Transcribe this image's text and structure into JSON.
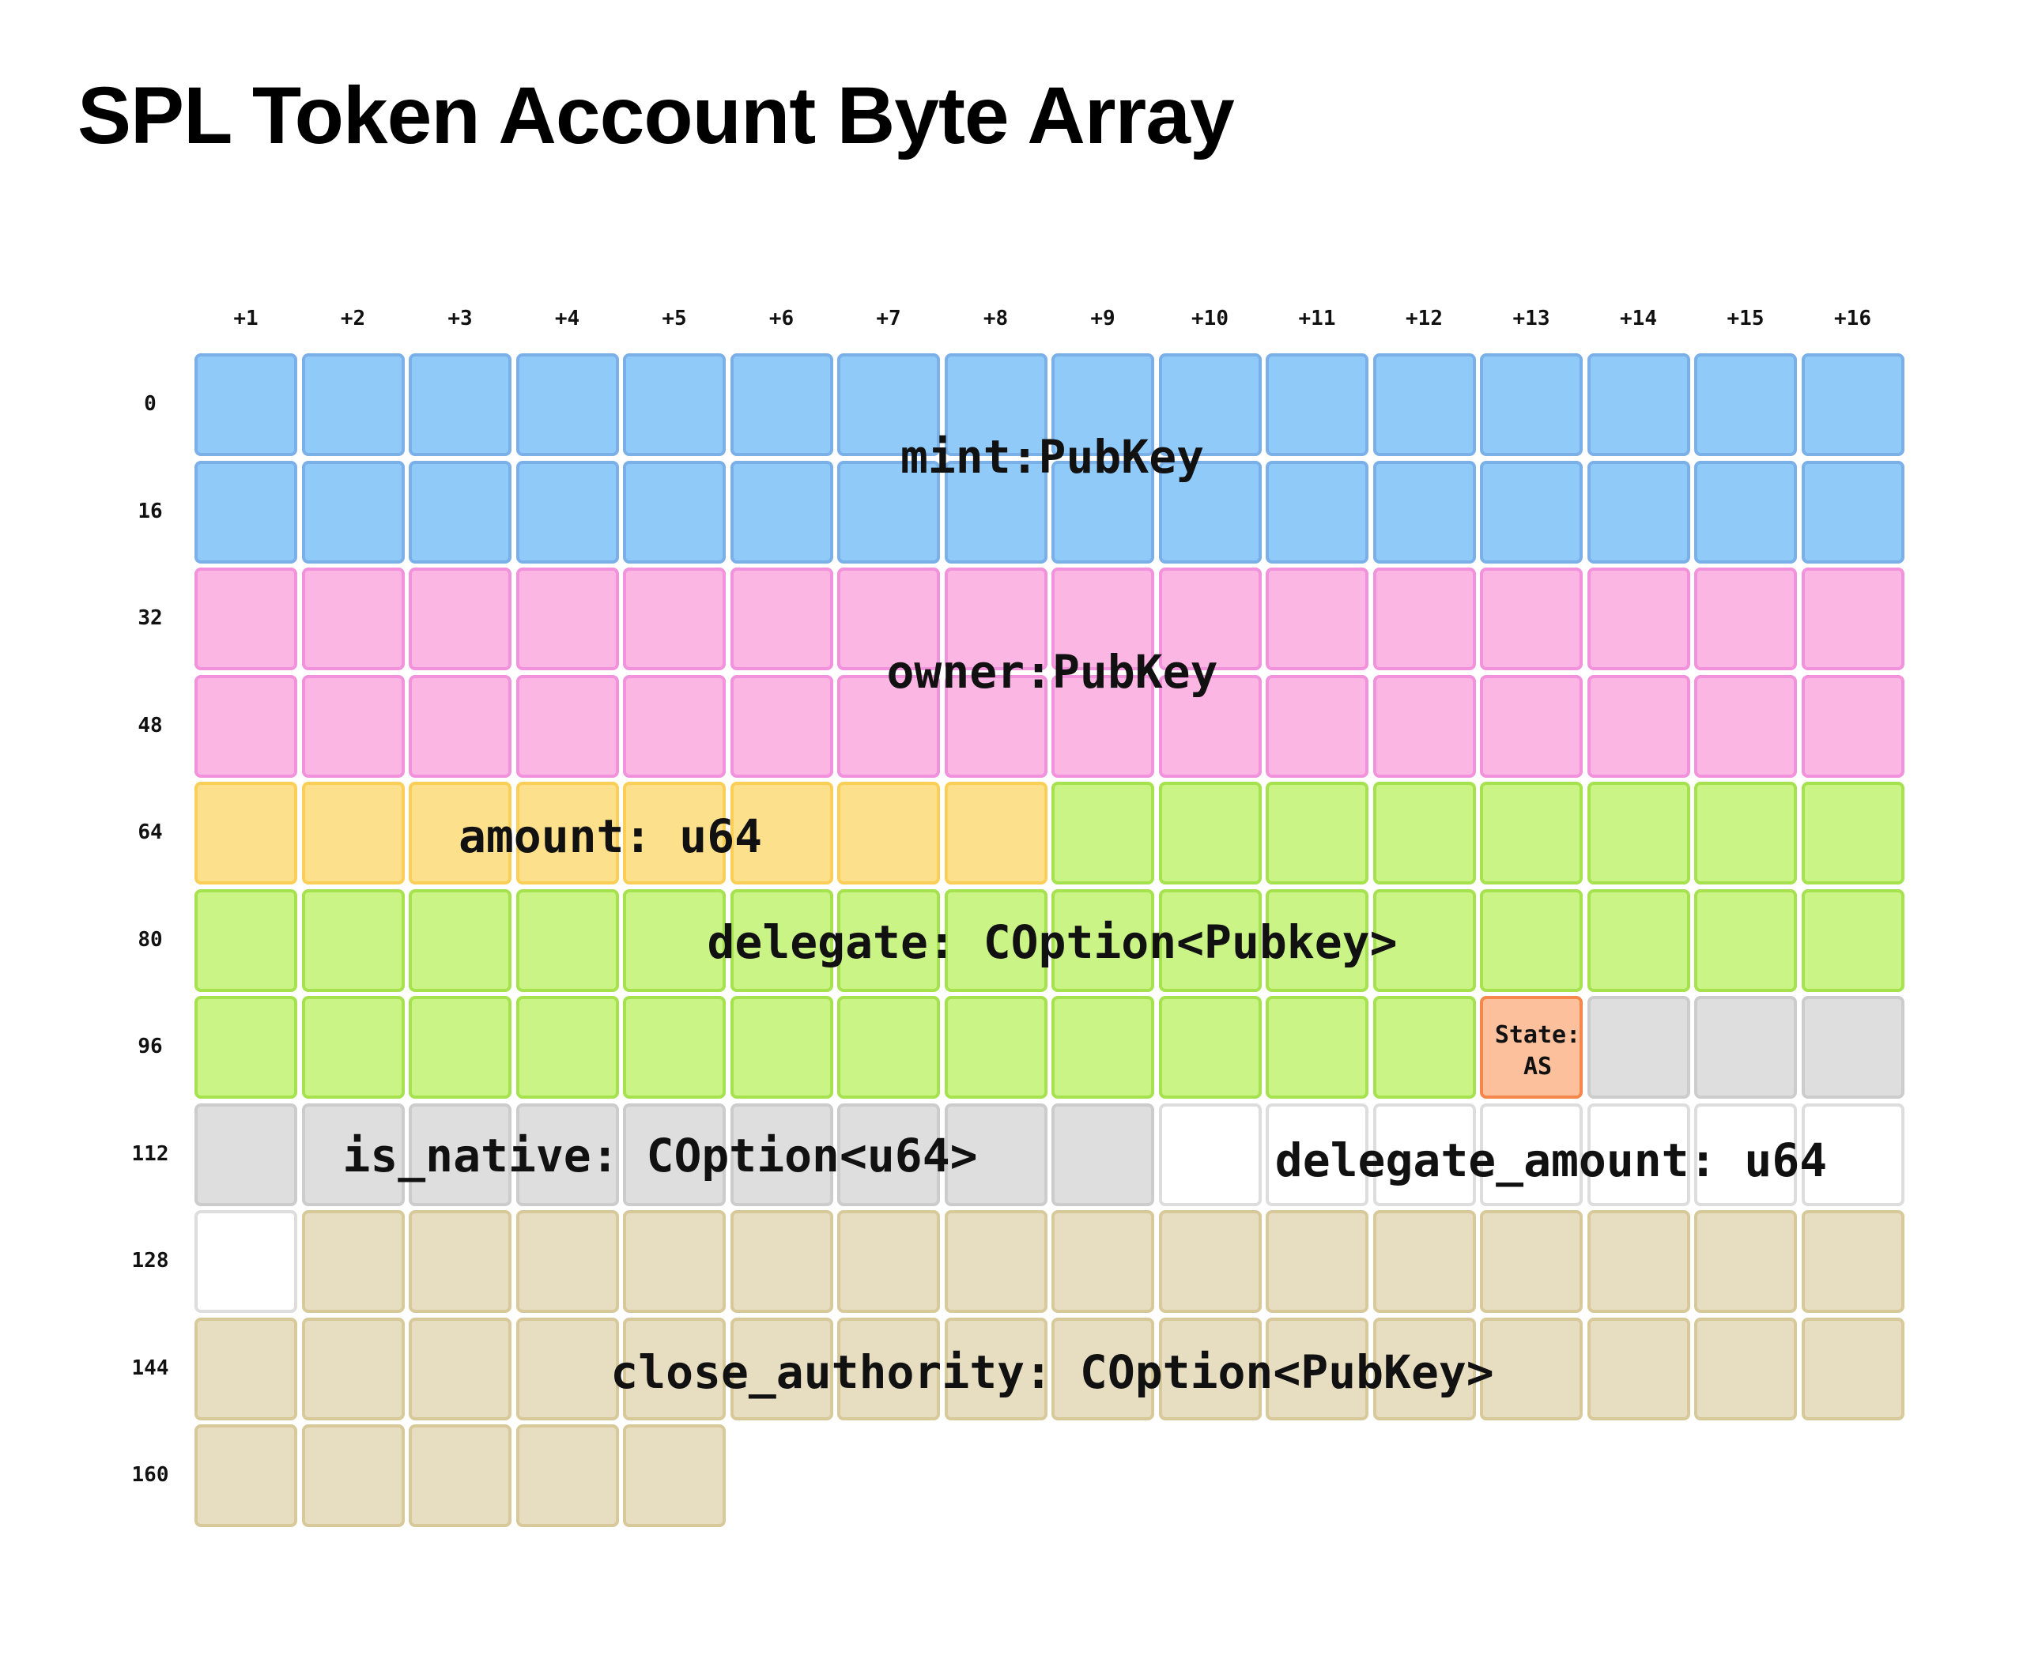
{
  "title": "SPL Token Account Byte Array",
  "column_headers": [
    "+1",
    "+2",
    "+3",
    "+4",
    "+5",
    "+6",
    "+7",
    "+8",
    "+9",
    "+10",
    "+11",
    "+12",
    "+13",
    "+14",
    "+15",
    "+16"
  ],
  "row_headers": [
    "0",
    "16",
    "32",
    "48",
    "64",
    "80",
    "96",
    "112",
    "128",
    "144",
    "160"
  ],
  "total_bytes": 165,
  "fields": [
    {
      "id": "mint",
      "label": "mint:PubKey",
      "start": 0,
      "length": 32,
      "fill": "#90caf9",
      "border": "#7aafe8"
    },
    {
      "id": "owner",
      "label": "owner:PubKey",
      "start": 32,
      "length": 32,
      "fill": "#fbb6e3",
      "border": "#f291dc"
    },
    {
      "id": "amount",
      "label": "amount: u64",
      "start": 64,
      "length": 8,
      "fill": "#fde08c",
      "border": "#fbcf57"
    },
    {
      "id": "delegate",
      "label": "delegate: COption<Pubkey>",
      "start": 72,
      "length": 36,
      "fill": "#caf486",
      "border": "#a5e24e"
    },
    {
      "id": "state",
      "label_line1": "State:",
      "label_line2": "AS",
      "start": 108,
      "length": 1,
      "fill": "#fdc09c",
      "border": "#f5874a"
    },
    {
      "id": "is_native",
      "label": "is_native: COption<u64>",
      "start": 109,
      "length": 12,
      "fill": "#dedede",
      "border": "#cccccc"
    },
    {
      "id": "delegate_amount",
      "label": "delegate_amount: u64",
      "start": 121,
      "length": 8,
      "fill": "#ffffff",
      "border": "#dddddd"
    },
    {
      "id": "close_authority",
      "label": "close_authority: COption<PubKey>",
      "start": 129,
      "length": 36,
      "fill": "#e7ddc0",
      "border": "#d8c99b"
    }
  ]
}
